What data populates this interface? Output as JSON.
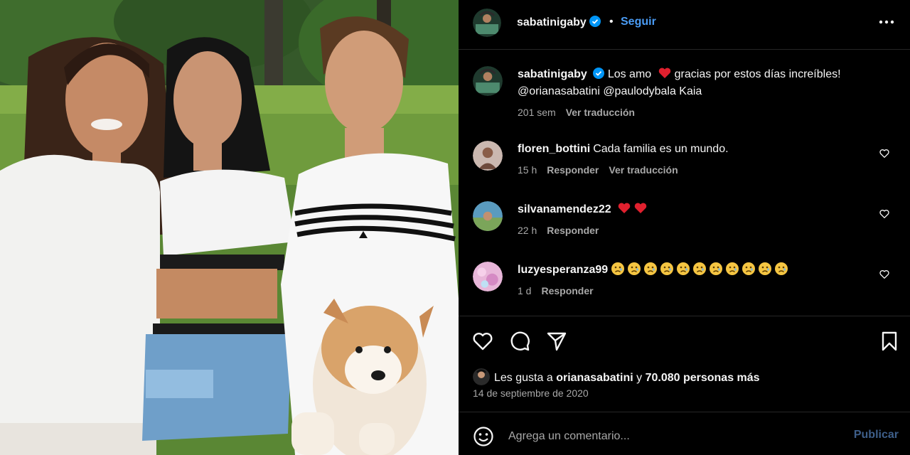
{
  "post": {
    "username": "sabatinigaby",
    "follow_label": "Seguir",
    "dot": "•",
    "more_icon": "more-horizontal-icon"
  },
  "caption": {
    "username": "sabatinigaby",
    "text_before_heart": "Los amo",
    "text_after_heart": "gracias por estos días increíbles!",
    "line2": "@orianasabatini @paulodybala Kaia",
    "time": "201 sem",
    "translate_label": "Ver traducción"
  },
  "comments": [
    {
      "username": "floren_bottini",
      "text": "Cada familia es un mundo.",
      "time": "15 h",
      "reply_label": "Responder",
      "translate_label": "Ver traducción"
    },
    {
      "username": "silvanamendez22",
      "text": "",
      "time": "22 h",
      "reply_label": "Responder"
    },
    {
      "username": "luzyesperanza99",
      "text": "",
      "time": "1 d",
      "reply_label": "Responder"
    }
  ],
  "likes": {
    "prefix": "Les gusta a",
    "user": "orianasabatini",
    "connector": "y",
    "count": "70.080 personas más"
  },
  "date": "14 de septiembre de 2020",
  "composer": {
    "placeholder": "Agrega un comentario...",
    "publish_label": "Publicar"
  },
  "colors": {
    "accent": "#4a9cf5",
    "publish_disabled": "#3e5f8a",
    "heart_red": "#ff3040",
    "muted_text": "#a8a8a8",
    "divider": "#262626"
  }
}
